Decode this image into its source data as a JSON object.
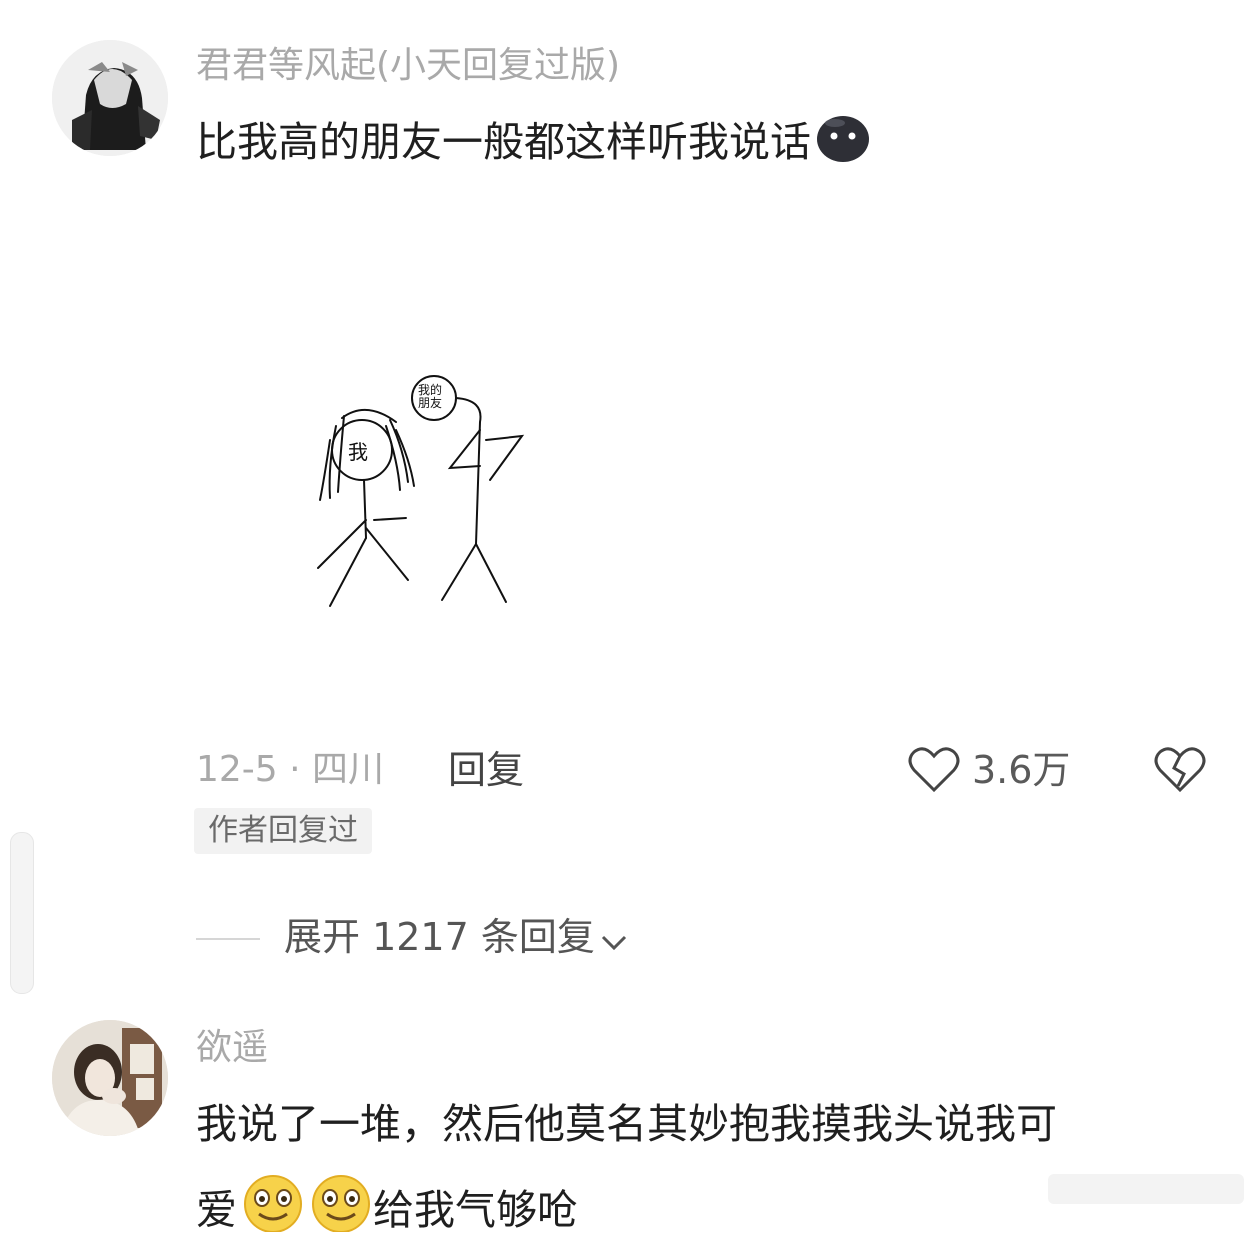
{
  "comment1": {
    "username": "君君等风起",
    "user_tag": "(小天回复过版)",
    "text": "比我高的朋友一般都这样听我说话",
    "emoji_icon": "dark-round-face-icon",
    "drawing_labels": {
      "me": "我",
      "friend": "我的朋友"
    },
    "date_location": "12-5 · 四川",
    "reply_label": "回复",
    "author_replied_badge": "作者回复过",
    "like_count": "3.6万",
    "expand_replies": "展开 1217 条回复"
  },
  "comment2": {
    "username": "欲遥",
    "text_line1": "我说了一堆，然后他莫名其妙抱我摸我头说我可",
    "text_line2_a": "爱",
    "text_line2_b": "给我气够呛",
    "emoji_icon": "smiling-face-icon"
  }
}
